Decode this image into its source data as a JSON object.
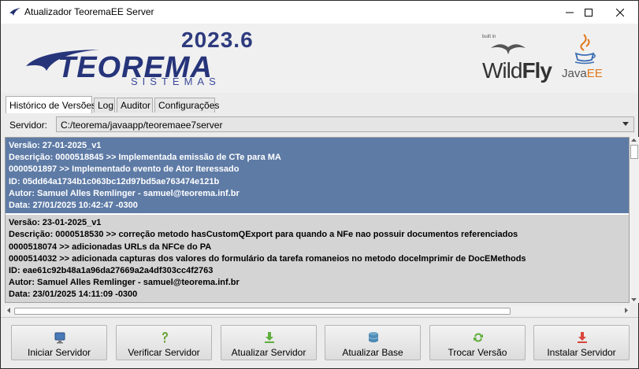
{
  "window": {
    "title": "Atualizador TeoremaEE Server"
  },
  "header": {
    "version": "2023.6",
    "logo_brand": "TEOREMA",
    "logo_sub": "SISTEMAS",
    "wildfly_builtin": "built in",
    "wildfly_text_light": "Wild",
    "wildfly_text_bold": "Fly",
    "java_text": "Java",
    "java_ee": "EE"
  },
  "tabs": [
    {
      "label": "Histórico de Versões",
      "active": true
    },
    {
      "label": "Log",
      "active": false
    },
    {
      "label": "Auditor",
      "active": false
    },
    {
      "label": "Configurações",
      "active": false
    }
  ],
  "server": {
    "label": "Servidor:",
    "value": "C:/teorema/javaapp/teoremaee7server"
  },
  "history": [
    {
      "selected": true,
      "lines": [
        "Versão: 27-01-2025_v1",
        "Descrição: 0000518845 >> Implementada emissão de CTe para MA",
        "0000501897 >> Implementado evento de Ator Iteressado",
        "ID: 05dd64a1734b1c063bc12d97bd5ae763474e121b",
        "Autor: Samuel Alles Remlinger - samuel@teorema.inf.br",
        "Data: 27/01/2025 10:42:47 -0300"
      ]
    },
    {
      "selected": false,
      "lines": [
        "Versão: 23-01-2025_v1",
        "Descrição: 0000518530 >> correção metodo hasCustomQExport para quando a NFe nao possuir documentos referenciados",
        "0000518074 >> adicionadas URLs da NFCe do PA",
        "0000514032 >> adicionada capturas dos valores do formulário da tarefa romaneios no metodo docelmprimir de DocEMethods",
        "ID: eae61c92b48a1a96da27669a2a4df303cc4f2763",
        "Autor: Samuel Alles Remlinger - samuel@teorema.inf.br",
        "Data: 23/01/2025 14:11:09 -0300"
      ]
    }
  ],
  "buttons": [
    {
      "label": "Iniciar Servidor",
      "icon": "monitor-icon"
    },
    {
      "label": "Verificar Servidor",
      "icon": "question-icon"
    },
    {
      "label": "Atualizar Servidor",
      "icon": "download-icon"
    },
    {
      "label": "Atualizar Base",
      "icon": "database-icon"
    },
    {
      "label": "Trocar Versão",
      "icon": "refresh-icon"
    },
    {
      "label": "Instalar Servidor",
      "icon": "install-icon"
    }
  ],
  "colors": {
    "selected_row": "#5e7ba6",
    "brand_blue": "#2e3b7e"
  }
}
